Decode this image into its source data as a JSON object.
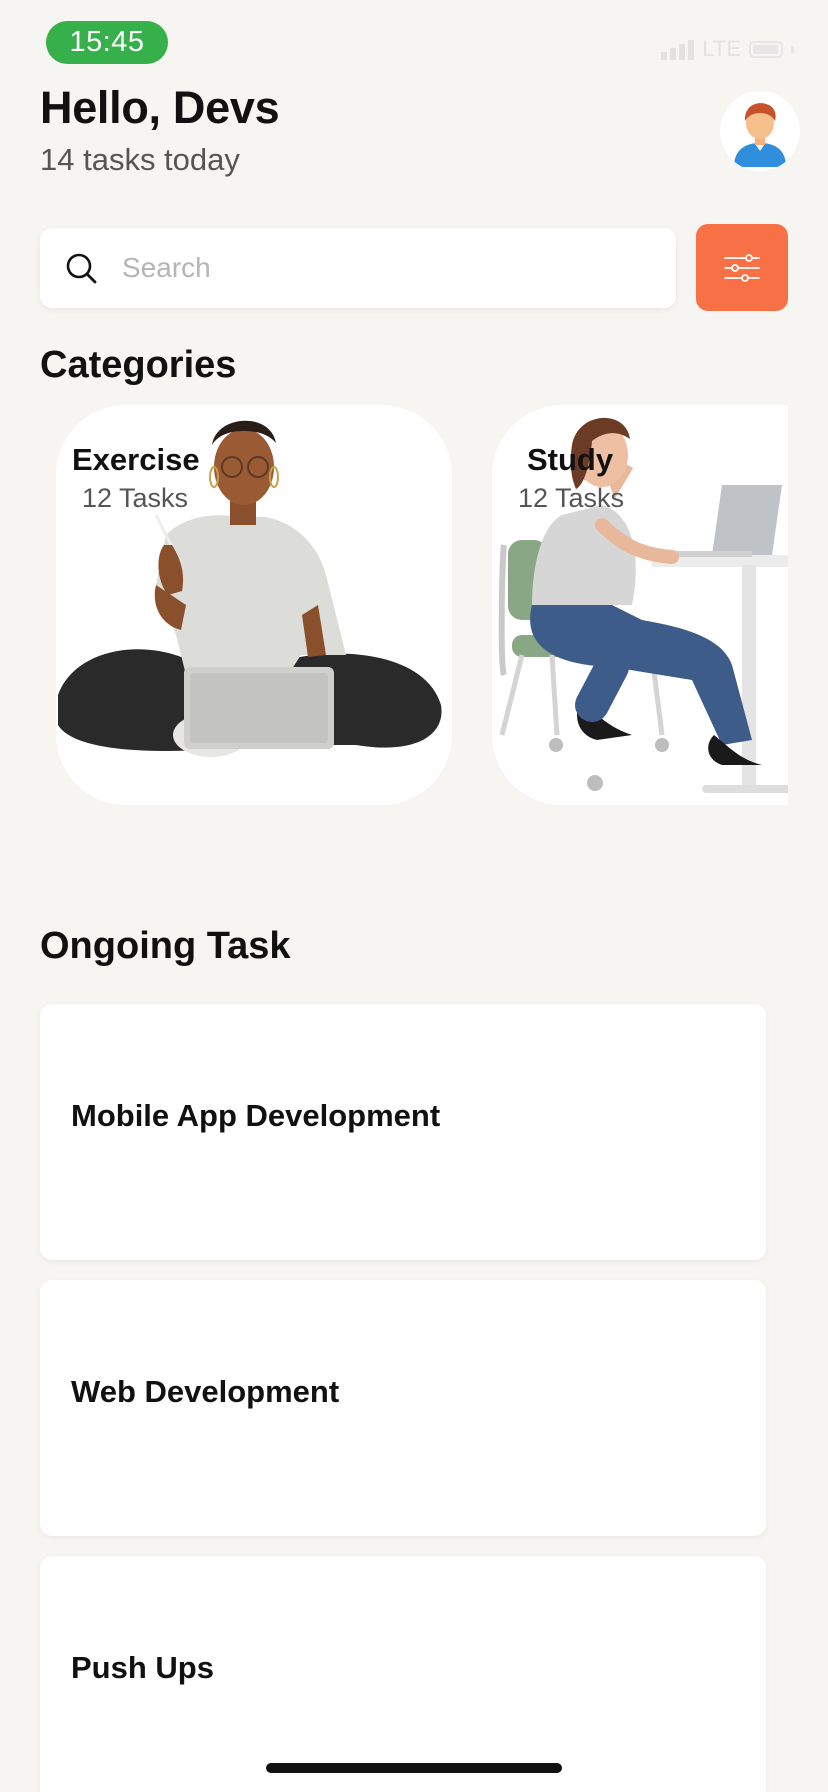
{
  "status_bar": {
    "time": "15:45",
    "network": "LTE"
  },
  "header": {
    "greeting": "Hello, Devs",
    "subtitle": "14 tasks today"
  },
  "search": {
    "placeholder": "Search"
  },
  "categories": {
    "title": "Categories",
    "items": [
      {
        "title": "Exercise",
        "count": "12 Tasks"
      },
      {
        "title": "Study",
        "count": "12 Tasks"
      }
    ]
  },
  "ongoing": {
    "title": "Ongoing Task",
    "items": [
      {
        "title": "Mobile App Development"
      },
      {
        "title": "Web Development"
      },
      {
        "title": "Push Ups"
      }
    ]
  },
  "colors": {
    "accent": "#f87046",
    "time_pill": "#35b04a",
    "background": "#f7f5f1"
  },
  "icons": {
    "search": "search-icon",
    "filter": "sliders-icon",
    "avatar": "person-avatar-icon"
  }
}
